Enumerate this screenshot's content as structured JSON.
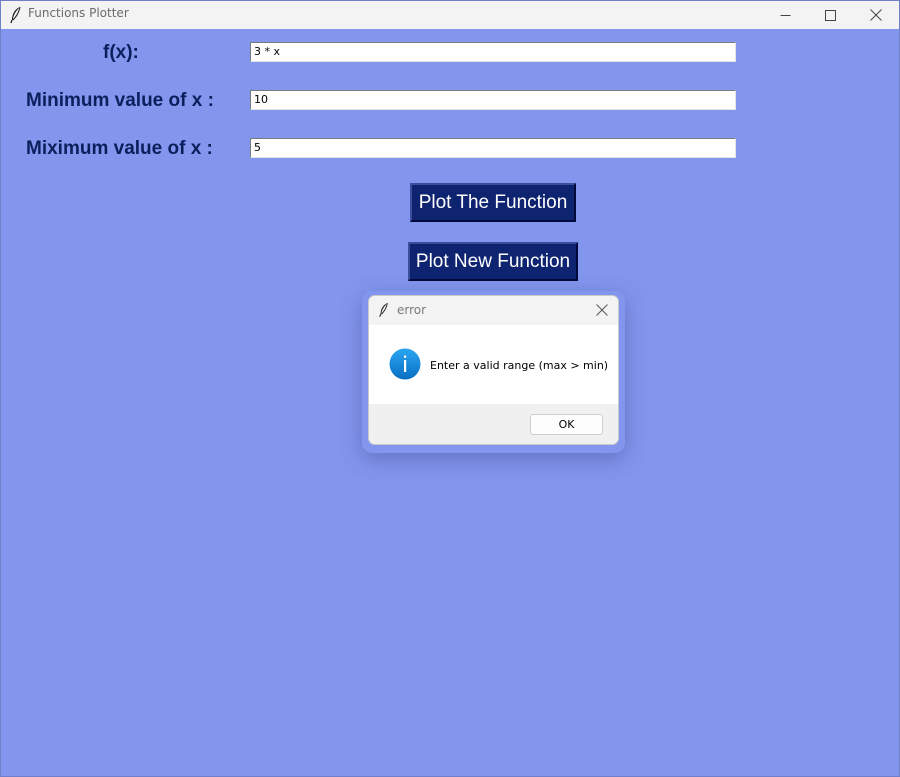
{
  "window": {
    "title": "Functions Plotter",
    "background": "#8396ee"
  },
  "form": {
    "fx_label": "f(x):",
    "fx_value": "3 * x",
    "min_label": "Minimum value of x :",
    "min_value": "10",
    "max_label": "Miximum value of x :",
    "max_value": "5"
  },
  "buttons": {
    "plot_label": "Plot The Function",
    "new_label": "Plot New Function",
    "color": "#0f2470"
  },
  "dialog": {
    "title": "error",
    "message": "Enter a valid range (max > min)",
    "ok_label": "OK",
    "icon": "info-icon"
  },
  "icons": {
    "app": "feather-icon",
    "minimize": "minimize-icon",
    "maximize": "maximize-icon",
    "close": "close-icon"
  }
}
